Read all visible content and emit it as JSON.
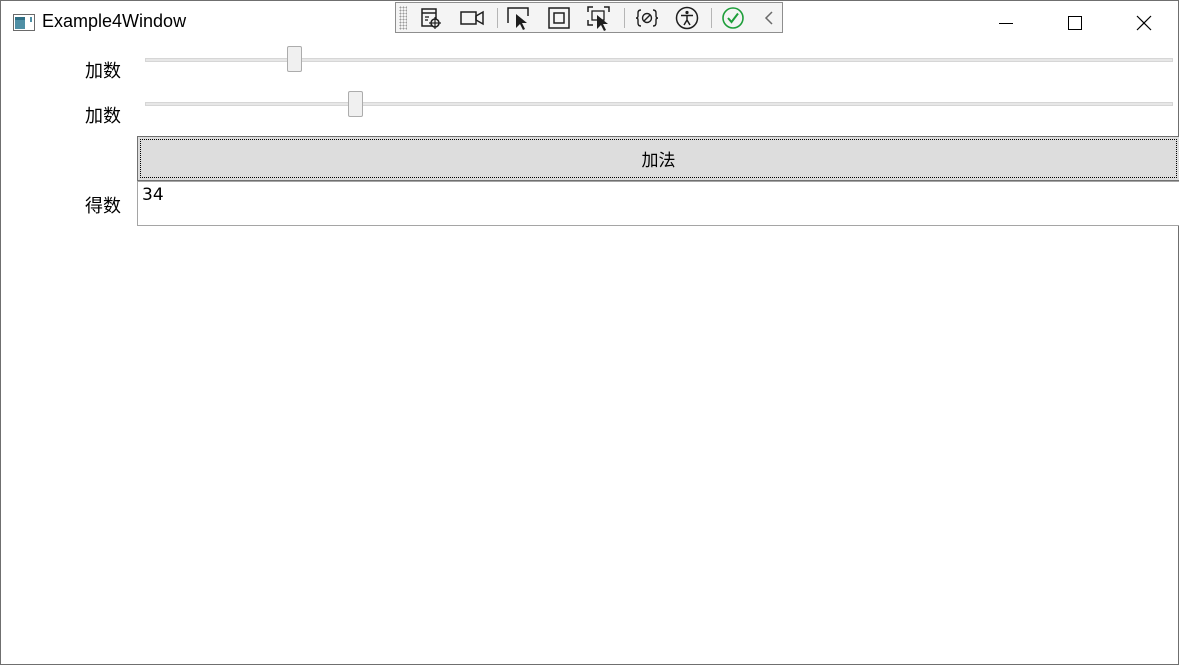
{
  "window": {
    "title": "Example4Window"
  },
  "toolbar": {
    "items": [
      {
        "icon": "visual-tree-icon"
      },
      {
        "icon": "record-icon"
      },
      {
        "icon": "select-element-icon"
      },
      {
        "icon": "display-layout-adorners-icon"
      },
      {
        "icon": "track-focused-element-icon"
      },
      {
        "icon": "binding-failures-icon"
      },
      {
        "icon": "accessibility-icon"
      },
      {
        "icon": "hot-reload-ok-icon"
      },
      {
        "icon": "collapse-chevron-icon"
      }
    ],
    "ok_color": "#1e9e3a"
  },
  "form": {
    "addend1_label": "加数",
    "addend1_value": 0.14,
    "addend2_label": "加数",
    "addend2_value": 0.2,
    "add_button_label": "加法",
    "result_label": "得数",
    "result_value": "34"
  }
}
